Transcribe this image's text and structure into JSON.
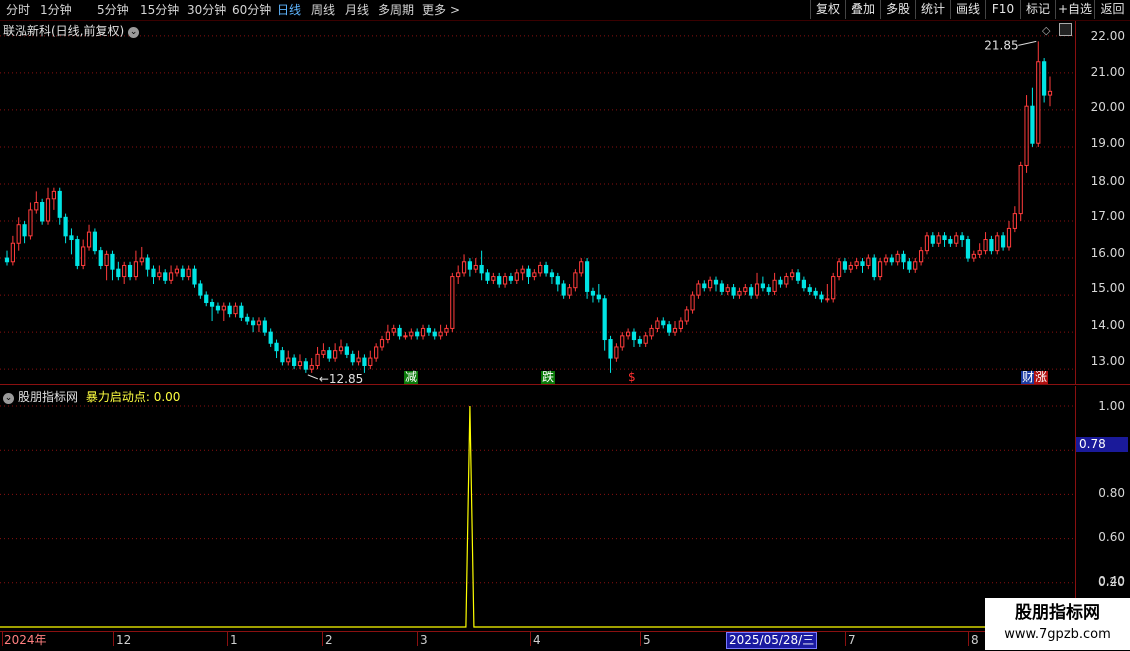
{
  "toolbar": {
    "periods": [
      "分时",
      "1分钟",
      "5分钟",
      "15分钟",
      "30分钟",
      "60分钟",
      "日线",
      "周线",
      "月线",
      "多周期",
      "更多"
    ],
    "active_period": "日线",
    "more_arrow": ">",
    "buttons": [
      "复权",
      "叠加",
      "多股",
      "统计",
      "画线",
      "F10",
      "标记",
      "+自选",
      "返回"
    ]
  },
  "price_panel": {
    "stock_title": "联泓新科(日线,前复权)",
    "title_icon": "chevron-down-icon",
    "y_ticks": [
      "22.00",
      "21.00",
      "20.00",
      "19.00",
      "18.00",
      "17.00",
      "16.00",
      "15.00",
      "14.00",
      "13.00"
    ],
    "high_label": "21.85",
    "low_label": "12.85",
    "signals": [
      {
        "text": "减",
        "color": "#ffffff",
        "bg": "#0a7a0a"
      },
      {
        "text": "跌",
        "color": "#ffffff",
        "bg": "#0a7a0a"
      },
      {
        "text": "$",
        "color": "#ff3030",
        "bg": ""
      },
      {
        "text": "财",
        "color": "#ffffff",
        "bg": "#1a3aa0"
      },
      {
        "text": "涨",
        "color": "#ffffff",
        "bg": "#b01010"
      }
    ]
  },
  "indicator_panel": {
    "name": "股朋指标网",
    "series_label": "暴力启动点: 0.00",
    "y_ticks": [
      "1.00",
      "0.80",
      "0.60",
      "0.40",
      "0.20"
    ],
    "current_value": "0.78"
  },
  "date_axis": {
    "labels": [
      "2024年",
      "12",
      "1",
      "2",
      "3",
      "4",
      "5",
      "7",
      "8"
    ],
    "cursor_date": "2025/05/28/三"
  },
  "watermark": {
    "line1": "股朋指标网",
    "line2": "www.7gpzb.com"
  },
  "colors": {
    "up": "#ff3c3c",
    "down": "#00e4e4",
    "grid": "#8a1010",
    "indicator_line": "#ffff00",
    "active": "#5fb6ff"
  },
  "chart_data": {
    "type": "candlestick",
    "y_range": [
      12.6,
      22.4
    ],
    "candles": [
      [
        16.0,
        15.9,
        16.2,
        15.8
      ],
      [
        15.9,
        16.4,
        16.6,
        15.8
      ],
      [
        16.4,
        16.9,
        17.1,
        16.2
      ],
      [
        16.9,
        16.6,
        17.0,
        16.4
      ],
      [
        16.6,
        17.3,
        17.5,
        16.5
      ],
      [
        17.3,
        17.5,
        17.8,
        17.2
      ],
      [
        17.5,
        17.0,
        17.6,
        16.9
      ],
      [
        17.0,
        17.6,
        17.9,
        16.9
      ],
      [
        17.6,
        17.8,
        17.9,
        17.3
      ],
      [
        17.8,
        17.1,
        17.9,
        16.9
      ],
      [
        17.1,
        16.6,
        17.2,
        16.4
      ],
      [
        16.6,
        16.5,
        16.8,
        16.1
      ],
      [
        16.5,
        15.8,
        16.6,
        15.7
      ],
      [
        15.8,
        16.3,
        16.5,
        15.7
      ],
      [
        16.3,
        16.7,
        16.9,
        16.2
      ],
      [
        16.7,
        16.2,
        16.8,
        16.1
      ],
      [
        16.2,
        15.8,
        16.3,
        15.7
      ],
      [
        15.8,
        16.1,
        16.2,
        15.4
      ],
      [
        16.1,
        15.7,
        16.2,
        15.4
      ],
      [
        15.7,
        15.5,
        15.9,
        15.4
      ],
      [
        15.5,
        15.8,
        15.9,
        15.3
      ],
      [
        15.8,
        15.5,
        15.9,
        15.4
      ],
      [
        15.5,
        15.9,
        16.2,
        15.4
      ],
      [
        15.9,
        16.0,
        16.3,
        15.8
      ],
      [
        16.0,
        15.7,
        16.1,
        15.5
      ],
      [
        15.7,
        15.5,
        15.8,
        15.3
      ],
      [
        15.5,
        15.6,
        15.8,
        15.4
      ],
      [
        15.6,
        15.4,
        15.7,
        15.3
      ],
      [
        15.4,
        15.6,
        15.8,
        15.3
      ],
      [
        15.6,
        15.7,
        15.8,
        15.5
      ],
      [
        15.7,
        15.5,
        15.8,
        15.4
      ],
      [
        15.5,
        15.7,
        15.8,
        15.4
      ],
      [
        15.7,
        15.3,
        15.8,
        15.2
      ],
      [
        15.3,
        15.0,
        15.4,
        14.9
      ],
      [
        15.0,
        14.8,
        15.1,
        14.7
      ],
      [
        14.8,
        14.7,
        14.9,
        14.3
      ],
      [
        14.7,
        14.6,
        14.8,
        14.5
      ],
      [
        14.6,
        14.7,
        14.8,
        14.3
      ],
      [
        14.7,
        14.5,
        14.8,
        14.4
      ],
      [
        14.5,
        14.7,
        14.8,
        14.4
      ],
      [
        14.7,
        14.4,
        14.8,
        14.3
      ],
      [
        14.4,
        14.3,
        14.5,
        14.2
      ],
      [
        14.3,
        14.2,
        14.4,
        14.0
      ],
      [
        14.2,
        14.3,
        14.4,
        14.0
      ],
      [
        14.3,
        14.0,
        14.4,
        13.9
      ],
      [
        14.0,
        13.7,
        14.1,
        13.6
      ],
      [
        13.7,
        13.5,
        13.8,
        13.3
      ],
      [
        13.5,
        13.2,
        13.6,
        13.1
      ],
      [
        13.2,
        13.3,
        13.5,
        13.1
      ],
      [
        13.3,
        13.1,
        13.4,
        13.0
      ],
      [
        13.1,
        13.2,
        13.4,
        13.0
      ],
      [
        13.2,
        13.0,
        13.3,
        12.9
      ],
      [
        13.0,
        13.1,
        13.3,
        12.9
      ],
      [
        13.1,
        13.4,
        13.6,
        13.0
      ],
      [
        13.4,
        13.5,
        13.7,
        13.3
      ],
      [
        13.5,
        13.3,
        13.6,
        13.2
      ],
      [
        13.3,
        13.5,
        13.7,
        13.2
      ],
      [
        13.5,
        13.6,
        13.8,
        13.4
      ],
      [
        13.6,
        13.4,
        13.7,
        13.3
      ],
      [
        13.4,
        13.2,
        13.5,
        13.1
      ],
      [
        13.2,
        13.3,
        13.5,
        13.1
      ],
      [
        13.3,
        13.1,
        13.4,
        12.9
      ],
      [
        13.1,
        13.3,
        13.5,
        13.0
      ],
      [
        13.3,
        13.6,
        13.7,
        13.2
      ],
      [
        13.6,
        13.8,
        13.9,
        13.5
      ],
      [
        13.8,
        14.0,
        14.2,
        13.7
      ],
      [
        14.0,
        14.1,
        14.2,
        13.9
      ],
      [
        14.1,
        13.9,
        14.2,
        13.8
      ],
      [
        13.9,
        13.9,
        14.0,
        13.8
      ],
      [
        13.9,
        14.0,
        14.1,
        13.8
      ],
      [
        14.0,
        13.9,
        14.1,
        13.8
      ],
      [
        13.9,
        14.1,
        14.2,
        13.8
      ],
      [
        14.1,
        14.0,
        14.2,
        13.9
      ],
      [
        14.0,
        13.9,
        14.1,
        13.8
      ],
      [
        13.9,
        14.0,
        14.2,
        13.8
      ],
      [
        14.0,
        14.1,
        14.2,
        13.9
      ],
      [
        14.1,
        15.5,
        15.6,
        14.0
      ],
      [
        15.5,
        15.6,
        15.8,
        15.3
      ],
      [
        15.6,
        15.9,
        16.1,
        15.5
      ],
      [
        15.9,
        15.7,
        16.0,
        15.5
      ],
      [
        15.7,
        15.8,
        16.0,
        15.6
      ],
      [
        15.8,
        15.6,
        16.2,
        15.4
      ],
      [
        15.6,
        15.4,
        15.7,
        15.3
      ],
      [
        15.4,
        15.5,
        15.6,
        15.3
      ],
      [
        15.5,
        15.3,
        15.6,
        15.2
      ],
      [
        15.3,
        15.5,
        15.6,
        15.2
      ],
      [
        15.5,
        15.4,
        15.6,
        15.3
      ],
      [
        15.4,
        15.6,
        15.7,
        15.3
      ],
      [
        15.6,
        15.7,
        15.8,
        15.4
      ],
      [
        15.7,
        15.5,
        15.8,
        15.3
      ],
      [
        15.5,
        15.6,
        15.7,
        15.4
      ],
      [
        15.6,
        15.8,
        15.9,
        15.5
      ],
      [
        15.8,
        15.6,
        15.9,
        15.5
      ],
      [
        15.6,
        15.5,
        15.7,
        15.3
      ],
      [
        15.5,
        15.3,
        15.6,
        15.1
      ],
      [
        15.3,
        15.0,
        15.4,
        14.9
      ],
      [
        15.0,
        15.2,
        15.3,
        14.9
      ],
      [
        15.2,
        15.6,
        15.7,
        15.1
      ],
      [
        15.6,
        15.9,
        16.0,
        15.5
      ],
      [
        15.9,
        15.1,
        16.0,
        14.9
      ],
      [
        15.1,
        15.0,
        15.2,
        14.8
      ],
      [
        15.0,
        14.9,
        15.3,
        14.8
      ],
      [
        14.9,
        13.8,
        15.0,
        13.5
      ],
      [
        13.8,
        13.3,
        13.9,
        12.9
      ],
      [
        13.3,
        13.6,
        13.7,
        13.2
      ],
      [
        13.6,
        13.9,
        14.0,
        13.5
      ],
      [
        13.9,
        14.0,
        14.1,
        13.8
      ],
      [
        14.0,
        13.8,
        14.1,
        13.6
      ],
      [
        13.8,
        13.7,
        13.9,
        13.6
      ],
      [
        13.7,
        13.9,
        14.0,
        13.6
      ],
      [
        13.9,
        14.1,
        14.2,
        13.8
      ],
      [
        14.1,
        14.3,
        14.4,
        14.0
      ],
      [
        14.3,
        14.2,
        14.4,
        14.1
      ],
      [
        14.2,
        14.0,
        14.3,
        13.9
      ],
      [
        14.0,
        14.1,
        14.3,
        13.9
      ],
      [
        14.1,
        14.3,
        14.4,
        14.0
      ],
      [
        14.3,
        14.6,
        14.7,
        14.2
      ],
      [
        14.6,
        15.0,
        15.1,
        14.5
      ],
      [
        15.0,
        15.3,
        15.4,
        14.9
      ],
      [
        15.3,
        15.2,
        15.4,
        15.1
      ],
      [
        15.2,
        15.4,
        15.5,
        15.1
      ],
      [
        15.4,
        15.3,
        15.5,
        15.1
      ],
      [
        15.3,
        15.1,
        15.4,
        15.0
      ],
      [
        15.1,
        15.2,
        15.3,
        15.0
      ],
      [
        15.2,
        15.0,
        15.3,
        14.9
      ],
      [
        15.0,
        15.1,
        15.2,
        14.9
      ],
      [
        15.1,
        15.2,
        15.3,
        15.0
      ],
      [
        15.2,
        15.0,
        15.3,
        14.9
      ],
      [
        15.0,
        15.3,
        15.6,
        14.9
      ],
      [
        15.3,
        15.2,
        15.5,
        15.1
      ],
      [
        15.2,
        15.1,
        15.3,
        15.0
      ],
      [
        15.1,
        15.4,
        15.6,
        15.0
      ],
      [
        15.4,
        15.3,
        15.5,
        15.2
      ],
      [
        15.3,
        15.5,
        15.6,
        15.2
      ],
      [
        15.5,
        15.6,
        15.7,
        15.4
      ],
      [
        15.6,
        15.4,
        15.7,
        15.3
      ],
      [
        15.4,
        15.2,
        15.5,
        15.1
      ],
      [
        15.2,
        15.1,
        15.3,
        15.0
      ],
      [
        15.1,
        15.0,
        15.2,
        14.9
      ],
      [
        15.0,
        14.9,
        15.1,
        14.8
      ],
      [
        14.9,
        14.9,
        15.3,
        14.8
      ],
      [
        14.9,
        15.5,
        15.6,
        14.8
      ],
      [
        15.5,
        15.9,
        16.0,
        15.4
      ],
      [
        15.9,
        15.7,
        16.0,
        15.6
      ],
      [
        15.7,
        15.8,
        15.9,
        15.6
      ],
      [
        15.8,
        15.9,
        16.0,
        15.7
      ],
      [
        15.9,
        15.8,
        16.0,
        15.6
      ],
      [
        15.8,
        16.0,
        16.1,
        15.7
      ],
      [
        16.0,
        15.5,
        16.1,
        15.4
      ],
      [
        15.5,
        15.9,
        16.0,
        15.4
      ],
      [
        15.9,
        16.0,
        16.1,
        15.8
      ],
      [
        16.0,
        15.9,
        16.1,
        15.8
      ],
      [
        15.9,
        16.1,
        16.2,
        15.8
      ],
      [
        16.1,
        15.9,
        16.2,
        15.7
      ],
      [
        15.9,
        15.7,
        16.0,
        15.6
      ],
      [
        15.7,
        15.9,
        16.0,
        15.6
      ],
      [
        15.9,
        16.2,
        16.3,
        15.8
      ],
      [
        16.2,
        16.6,
        16.7,
        16.1
      ],
      [
        16.6,
        16.4,
        16.7,
        16.3
      ],
      [
        16.4,
        16.6,
        16.7,
        16.3
      ],
      [
        16.6,
        16.5,
        16.7,
        16.3
      ],
      [
        16.5,
        16.4,
        16.6,
        16.3
      ],
      [
        16.4,
        16.6,
        16.7,
        16.3
      ],
      [
        16.6,
        16.5,
        16.7,
        16.3
      ],
      [
        16.5,
        16.0,
        16.6,
        15.9
      ],
      [
        16.0,
        16.1,
        16.2,
        15.9
      ],
      [
        16.1,
        16.2,
        16.4,
        16.0
      ],
      [
        16.2,
        16.5,
        16.7,
        16.1
      ],
      [
        16.5,
        16.2,
        16.6,
        16.1
      ],
      [
        16.2,
        16.6,
        16.7,
        16.1
      ],
      [
        16.6,
        16.3,
        16.7,
        16.2
      ],
      [
        16.3,
        16.8,
        17.0,
        16.2
      ],
      [
        16.8,
        17.2,
        17.4,
        16.7
      ],
      [
        17.2,
        18.5,
        18.6,
        17.0
      ],
      [
        18.5,
        20.1,
        20.4,
        18.3
      ],
      [
        20.1,
        19.1,
        20.6,
        19.0
      ],
      [
        19.1,
        21.3,
        21.85,
        19.0
      ],
      [
        21.3,
        20.4,
        21.4,
        20.2
      ],
      [
        20.4,
        20.5,
        20.9,
        20.1
      ]
    ],
    "indicator_spikes": [
      0.0,
      1.0
    ]
  }
}
